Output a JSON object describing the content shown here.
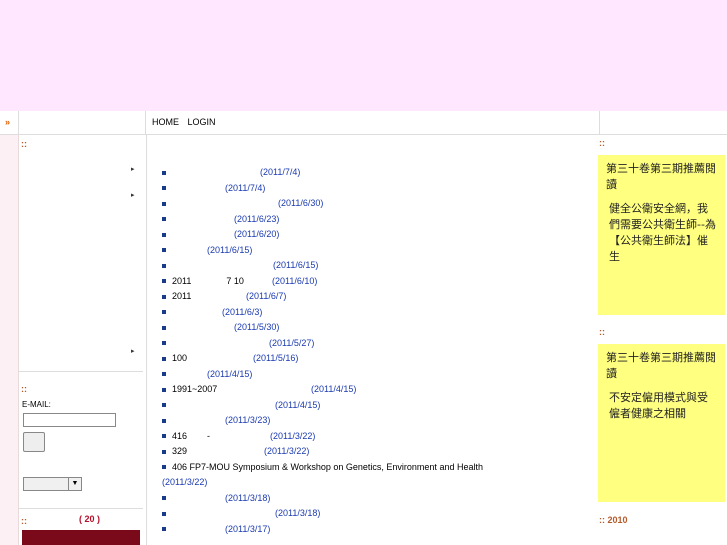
{
  "nav": {
    "arrow": "»",
    "links": [
      "HOME",
      "LOGIN"
    ]
  },
  "left": {
    "dots": "::",
    "menu_arrow": "▸",
    "email_label": "E-MAIL:",
    "heading": "( 20 )"
  },
  "news": [
    {
      "pre": "",
      "date": "(2011/7/4)"
    },
    {
      "pre": "",
      "date": "(2011/7/4)"
    },
    {
      "pre": "",
      "date": "(2011/6/30)"
    },
    {
      "pre": "",
      "date": "(2011/6/23)"
    },
    {
      "pre": "",
      "date": "(2011/6/20)"
    },
    {
      "pre": "",
      "date": "(2011/6/15)"
    },
    {
      "pre": "",
      "date": "(2011/6/15)"
    },
    {
      "pre": "2011              7 10",
      "date": "(2011/6/10)"
    },
    {
      "pre": "2011",
      "date": "(2011/6/7)"
    },
    {
      "pre": "",
      "date": "(2011/6/3)"
    },
    {
      "pre": "",
      "date": "(2011/5/30)"
    },
    {
      "pre": "",
      "date": "(2011/5/27)"
    },
    {
      "pre": "100",
      "date": "(2011/5/16)"
    },
    {
      "pre": "",
      "date": "(2011/4/15)"
    },
    {
      "pre": "1991~2007",
      "date": "(2011/4/15)"
    },
    {
      "pre": "",
      "date": "(2011/4/15)"
    },
    {
      "pre": "",
      "date": "(2011/3/23)"
    },
    {
      "pre": "416        -",
      "date": "(2011/3/22)"
    },
    {
      "pre": "329",
      "date": "(2011/3/22)"
    },
    {
      "pre": "406 FP7-MOU Symposium & Workshop on Genetics, Environment and Health",
      "date": ""
    },
    {
      "pre": "",
      "date": "(2011/3/22)"
    },
    {
      "pre": "",
      "date": "(2011/3/18)"
    },
    {
      "pre": "",
      "date": "(2011/3/18)"
    },
    {
      "pre": "",
      "date": "(2011/3/17)"
    }
  ],
  "right": {
    "dots": "::",
    "note1": {
      "title": "第三十卷第三期推薦閱讀",
      "body": "健全公衛安全網，我們需要公共衛生師--為【公共衛生師法】催生"
    },
    "note2": {
      "title": "第三十卷第三期推薦閱讀",
      "body": "不安定僱用模式與受僱者健康之相關"
    },
    "heading": ":: 2010"
  }
}
